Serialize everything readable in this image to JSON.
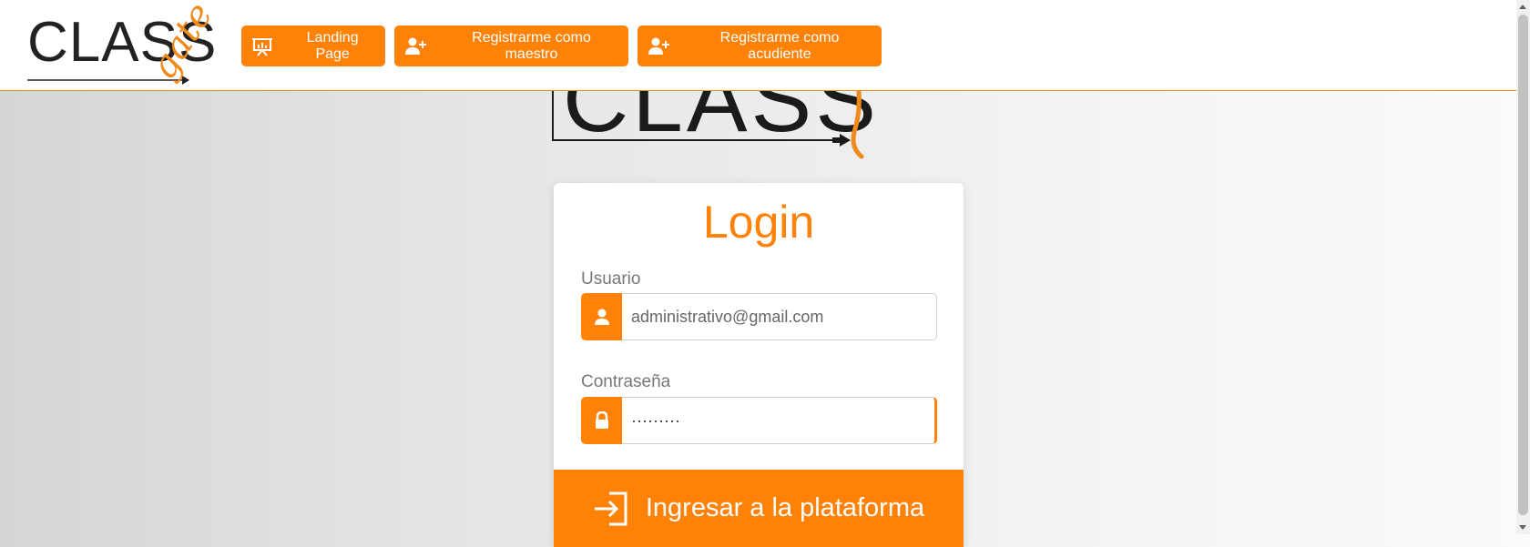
{
  "header": {
    "logo": {
      "word": "CLASS",
      "script": "gate"
    },
    "nav": [
      {
        "label": "Landing Page",
        "icon": "presentation-icon"
      },
      {
        "label": "Registrarme como maestro",
        "icon": "user-plus-icon"
      },
      {
        "label": "Registrarme como acudiente",
        "icon": "user-plus-icon"
      }
    ]
  },
  "login": {
    "title": "Login",
    "username": {
      "label": "Usuario",
      "value": "administrativo@gmail.com",
      "icon": "user-icon"
    },
    "password": {
      "label": "Contraseña",
      "value": "·········",
      "icon": "lock-icon"
    },
    "submit": {
      "label": "Ingresar a la plataforma",
      "icon": "sign-in-icon"
    }
  },
  "colors": {
    "accent": "#ff8208",
    "header_border": "#f08a1c",
    "text_muted": "#777777"
  }
}
